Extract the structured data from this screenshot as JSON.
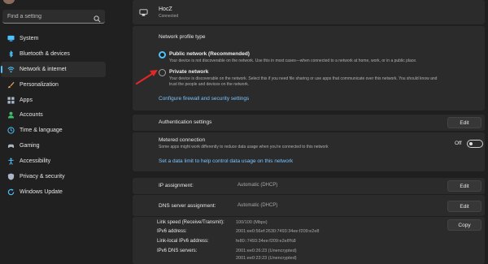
{
  "sidebar": {
    "search": {
      "placeholder": "Find a setting",
      "icon": "search-icon"
    },
    "items": [
      {
        "label": "System",
        "icon": "monitor-icon",
        "color": "#4cc2ff",
        "active": false
      },
      {
        "label": "Bluetooth & devices",
        "icon": "bluetooth-icon",
        "color": "#4cc2ff",
        "active": false
      },
      {
        "label": "Network & internet",
        "icon": "wifi-icon",
        "color": "#4cc2ff",
        "active": true
      },
      {
        "label": "Personalization",
        "icon": "brush-icon",
        "color": "#e8a25a",
        "active": false
      },
      {
        "label": "Apps",
        "icon": "apps-icon",
        "color": "#a9b7c6",
        "active": false
      },
      {
        "label": "Accounts",
        "icon": "person-icon",
        "color": "#3fbf6f",
        "active": false
      },
      {
        "label": "Time & language",
        "icon": "globe-clock-icon",
        "color": "#4cc2ff",
        "active": false
      },
      {
        "label": "Gaming",
        "icon": "gamepad-icon",
        "color": "#a9b7c6",
        "active": false
      },
      {
        "label": "Accessibility",
        "icon": "accessibility-icon",
        "color": "#4cc2ff",
        "active": false
      },
      {
        "label": "Privacy & security",
        "icon": "shield-icon",
        "color": "#a9b7c6",
        "active": false
      },
      {
        "label": "Windows Update",
        "icon": "update-icon",
        "color": "#4cc2ff",
        "active": false
      }
    ]
  },
  "network": {
    "name": "HocZ",
    "status": "Connected",
    "icon": "ethernet-icon"
  },
  "profile": {
    "title": "Network profile type",
    "options": [
      {
        "title": "Public network (Recommended)",
        "desc": "Your device is not discoverable on the network. Use this in most cases—when connected to a network at home, work, or in a public place.",
        "selected": true
      },
      {
        "title": "Private network",
        "desc_line1": "Your device is discoverable on the network. Select this if you need file sharing or use apps that communicate over this network. You should know and",
        "desc_line2": "trust the people and devices on the network.",
        "selected": false
      }
    ],
    "firewall_link": "Configure firewall and security settings"
  },
  "auth": {
    "label": "Authentication settings",
    "button": "Edit"
  },
  "metered": {
    "label": "Metered connection",
    "desc": "Some apps might work differently to reduce data usage when you're connected to this network",
    "toggle_label": "Off",
    "toggle_on": false,
    "data_limit_link": "Set a data limit to help control data usage on this network"
  },
  "ip": {
    "label": "IP assignment:",
    "value": "Automatic (DHCP)",
    "button": "Edit"
  },
  "dns": {
    "label": "DNS server assignment:",
    "value": "Automatic (DHCP)",
    "button": "Edit"
  },
  "properties": {
    "copy_button": "Copy",
    "rows": [
      {
        "label": "Link speed (Receive/Transmit):",
        "value": "100/100 (Mbps)"
      },
      {
        "label": "IPv6 address:",
        "value": "2001:ee0:56ef:2630:7493:34ee:f209:e2e8"
      },
      {
        "label": "Link-local IPv6 address:",
        "value": "fe80::7493:34ee:f209:e2e8%8"
      },
      {
        "label": "IPv6 DNS servers:",
        "value": "2001:ee0:26:23 (Unencrypted)"
      },
      {
        "label": "",
        "value": "2001:ee0:23:23 (Unencrypted)"
      }
    ]
  },
  "annotation": {
    "arrow_color": "#e02828"
  }
}
